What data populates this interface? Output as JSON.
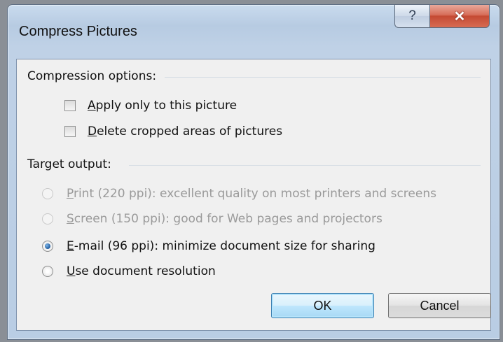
{
  "dialog": {
    "title": "Compress Pictures",
    "help_glyph": "?",
    "close_glyph": "✕"
  },
  "compression": {
    "group_label": "Compression options:",
    "apply_only": {
      "accel": "A",
      "rest": "pply only to this picture",
      "checked": false
    },
    "delete_cropped": {
      "accel": "D",
      "rest": "elete cropped areas of pictures",
      "checked": false
    }
  },
  "target": {
    "group_label": "Target output:",
    "options": [
      {
        "accel": "P",
        "rest": "rint (220 ppi): excellent quality on most printers and screens",
        "state": "disabled"
      },
      {
        "accel": "S",
        "rest": "creen (150 ppi): good for Web pages and projectors",
        "state": "disabled"
      },
      {
        "accel": "E",
        "rest": "-mail (96 ppi): minimize document size for sharing",
        "state": "selected"
      },
      {
        "accel": "U",
        "rest": "se document resolution",
        "state": "enabled"
      }
    ]
  },
  "buttons": {
    "ok": "OK",
    "cancel": "Cancel"
  },
  "colors": {
    "title_bar": "#bfd1e6",
    "close_button": "#c44a33",
    "client_bg": "#f0f0f0",
    "default_button_border": "#3c7fb1"
  }
}
